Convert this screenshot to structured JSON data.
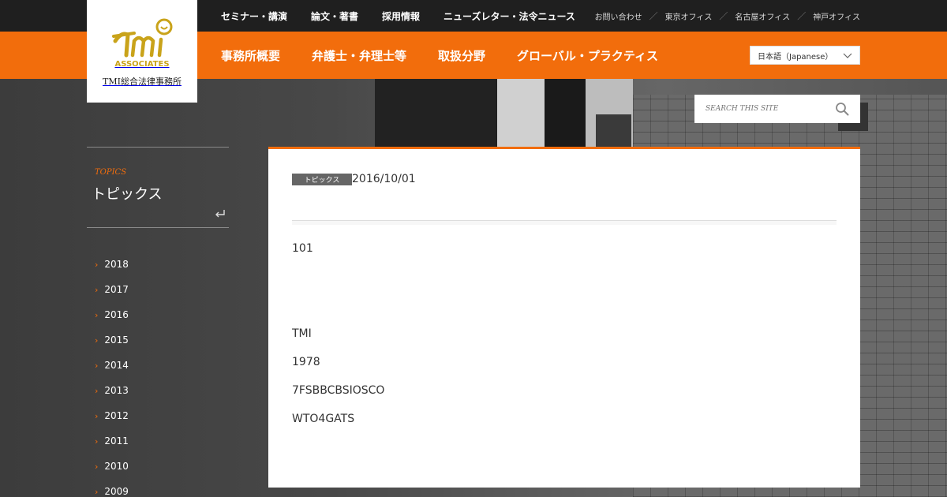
{
  "header": {
    "top_nav": [
      "セミナー・講演",
      "論文・著書",
      "採用情報",
      "ニューズレター・法令ニュース"
    ],
    "top_links": [
      "お問い合わせ",
      "東京オフィス",
      "名古屋オフィス",
      "神戸オフィス"
    ],
    "top_link_separator": "／",
    "main_nav": [
      "事務所概要",
      "弁護士・弁理士等",
      "取扱分野",
      "グローバル・プラクティス"
    ],
    "language": "日本語（Japanese）"
  },
  "logo": {
    "mark_text": "ASSOCIATES",
    "firm_name": "TMI総合法律事務所"
  },
  "search": {
    "placeholder": "SEARCH THIS SITE"
  },
  "sidebar": {
    "kicker": "TOPICS",
    "heading": "トピックス",
    "years": [
      "2018",
      "2017",
      "2016",
      "2015",
      "2014",
      "2013",
      "2012",
      "2011",
      "2010",
      "2009"
    ]
  },
  "article": {
    "tag": "トピックス",
    "date": "2016/10/01",
    "paragraphs": [
      "101",
      "TMI",
      "1978",
      "7FSBBCBSIOSCO",
      "WTO4GATS"
    ]
  },
  "colors": {
    "accent": "#f26d0c",
    "topbar": "#1f1f1f",
    "logo_gold": "#c9a31a"
  }
}
